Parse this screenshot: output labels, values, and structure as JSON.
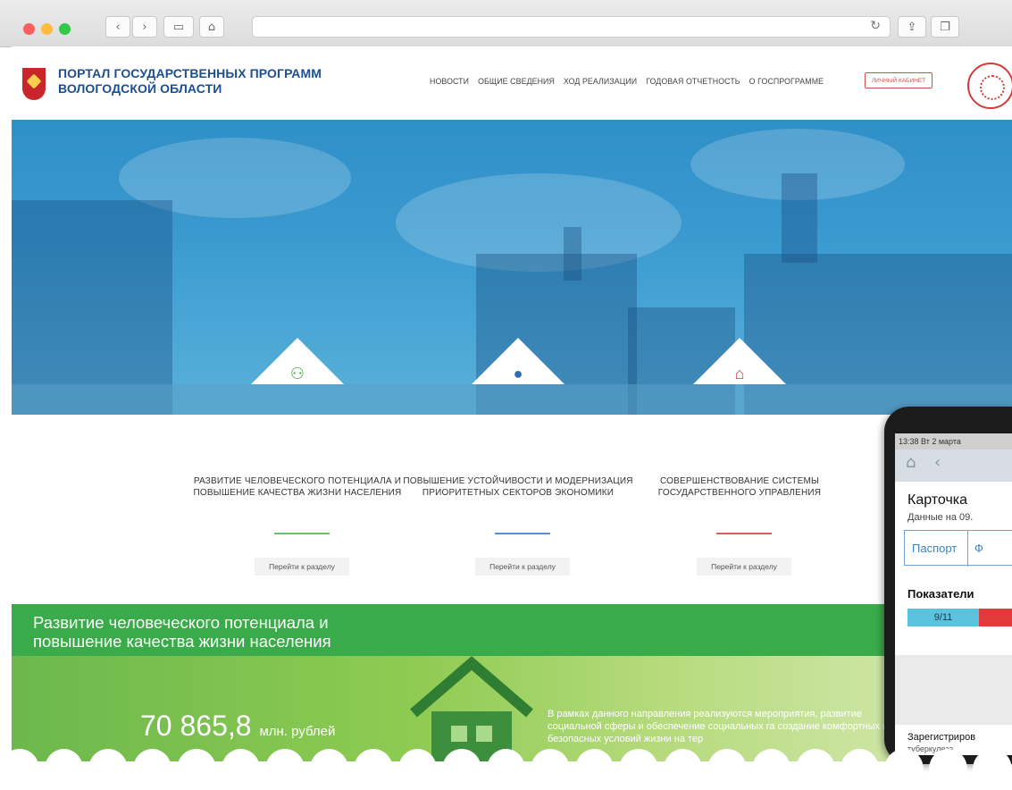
{
  "nav": {
    "brand_title": "ПОРТАЛ ГОСУДАРСТВЕННЫХ ПРОГРАММ ВОЛОГОДСКОЙ ОБЛАСТИ",
    "items": [
      "НОВОСТИ",
      "ОБЩИЕ СВЕДЕНИЯ",
      "ХОД РЕАЛИЗАЦИИ",
      "ГОДОВАЯ ОТЧЕТНОСТЬ",
      "О ГОСПРОГРАММЕ"
    ],
    "cabinet": "ЛИЧНЫЙ КАБИНЕТ"
  },
  "tiles": [
    {
      "text": "РАЗВИТИЕ ЧЕЛОВЕЧЕСКОГО ПОТЕНЦИАЛА И ПОВЫШЕНИЕ КАЧЕСТВА ЖИЗНИ НАСЕЛЕНИЯ",
      "button": "Перейти к разделу",
      "color": "#6cc06a"
    },
    {
      "text": "ПОВЫШЕНИЕ УСТОЙЧИВОСТИ И МОДЕРНИЗАЦИЯ ПРИОРИТЕТНЫХ СЕКТОРОВ ЭКОНОМИКИ",
      "button": "Перейти к разделу",
      "color": "#5b8fd3"
    },
    {
      "text": "СОВЕРШЕНСТВОВАНИЕ СИСТЕМЫ ГОСУДАРСТВЕННОГО УПРАВЛЕНИЯ",
      "button": "Перейти к разделу",
      "color": "#e05a5a"
    }
  ],
  "section": {
    "title": "Развитие человеческого потенциала и повышение качества жизни населения",
    "amount": "70 865,8",
    "unit": "млн. рублей",
    "text": "В рамках данного направления реализуются мероприятия, развитие социальной сферы и обеспечение социальных га создание комфортных и безопасных условий жизни на тер"
  },
  "tablet": {
    "status": "13:38  Вт 2 марта",
    "title": "Карточка",
    "sub": "Данные на 09.",
    "tab1": "Паспорт",
    "tab2": "Ф",
    "head": "Показатели",
    "bar_value": "9/11",
    "foot": "Зарегистриров",
    "foot2": "туберкулеза,"
  }
}
